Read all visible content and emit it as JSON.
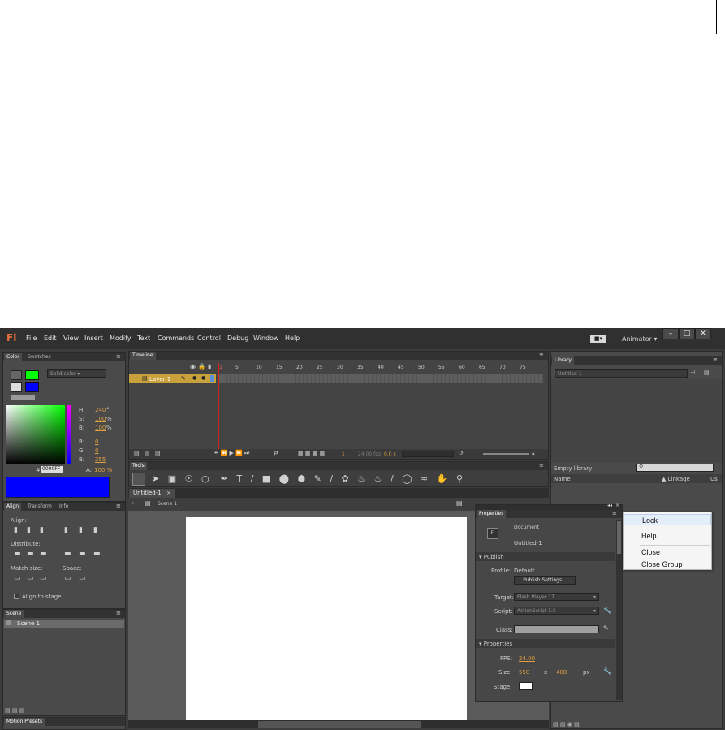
{
  "menubar": {
    "logo": "Fl",
    "items": [
      "File",
      "Edit",
      "View",
      "Insert",
      "Modify",
      "Text",
      "Commands",
      "Control",
      "Debug",
      "Window",
      "Help"
    ],
    "workspace_label": "Animator",
    "window_controls": [
      "minimize-icon",
      "maximize-icon",
      "close-icon"
    ]
  },
  "color_panel": {
    "tabs": [
      "Color",
      "Swatches"
    ],
    "fill_type": "Solid color",
    "hsb": [
      {
        "label": "H:",
        "value": "240",
        "unit": "°"
      },
      {
        "label": "S:",
        "value": "100",
        "unit": "%"
      },
      {
        "label": "B:",
        "value": "100",
        "unit": "%"
      }
    ],
    "rgb": [
      {
        "label": "R:",
        "value": "0"
      },
      {
        "label": "G:",
        "value": "0"
      },
      {
        "label": "B:",
        "value": "255"
      }
    ],
    "hex_prefix": "#",
    "hex": "0000FF",
    "alpha_label": "A:",
    "alpha": "100 %",
    "stroke_color": "#00ff00",
    "fill_color": "#0000ff"
  },
  "align_panel": {
    "tabs": [
      "Align",
      "Transform",
      "Info"
    ],
    "align_label": "Align:",
    "distribute_label": "Distribute:",
    "match_size_label": "Match size:",
    "space_label": "Space:",
    "align_to_stage": "Align to stage"
  },
  "scene_panel": {
    "title": "Scene",
    "items": [
      "Scene 1"
    ]
  },
  "motion_presets": {
    "title": "Motion Presets"
  },
  "timeline": {
    "title": "Timeline",
    "layer_name": "Layer 1",
    "frame_numbers": [
      "1",
      "5",
      "10",
      "15",
      "20",
      "25",
      "30",
      "35",
      "40",
      "45",
      "50",
      "55",
      "60",
      "65",
      "70",
      "75"
    ],
    "fps_readout": "24.00 fps",
    "time_readout": "0.0 s",
    "current_frame": "1"
  },
  "tools": {
    "title": "Tools"
  },
  "document_tab": {
    "name": "Untitled-1",
    "scene": "Scene 1"
  },
  "library": {
    "title": "Library",
    "document": "Untitled-1",
    "status": "Empty library",
    "columns": [
      "Name",
      "Linkage",
      "Us"
    ],
    "search_placeholder": ""
  },
  "properties": {
    "title": "Properties",
    "doc_type": "Document",
    "doc_name": "Untitled-1",
    "publish_section": "Publish",
    "profile_label": "Profile:",
    "profile_value": "Default",
    "publish_settings_btn": "Publish Settings...",
    "target_label": "Target:",
    "target_value": "Flash Player 17",
    "script_label": "Script:",
    "script_value": "ActionScript 3.0",
    "class_label": "Class:",
    "properties_section": "Properties",
    "fps_label": "FPS:",
    "fps_value": "24.00",
    "size_label": "Size:",
    "width": "550",
    "x": "x",
    "height": "400",
    "unit": "px",
    "stage_label": "Stage:"
  },
  "context_menu": {
    "items": [
      "Lock",
      "Help",
      "Close",
      "Close Group"
    ]
  }
}
